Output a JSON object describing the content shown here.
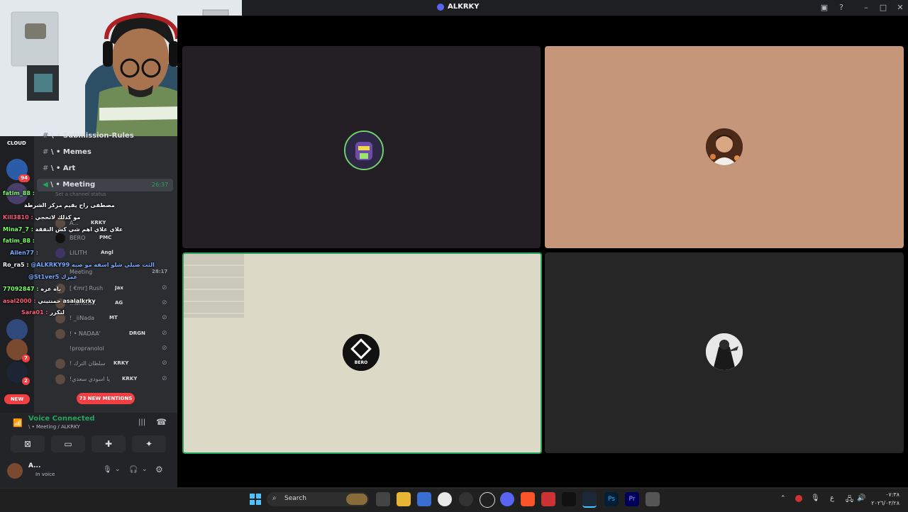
{
  "window": {
    "title": "ALKRKY",
    "title_icon": "discord-icon"
  },
  "channels": [
    {
      "label": "\\ • Submission-Rules"
    },
    {
      "label": "\\ • Memes"
    },
    {
      "label": "\\ • Art"
    },
    {
      "label": "\\ • Meeting",
      "time": "26:37",
      "status_placeholder": "Set a channel status"
    }
  ],
  "members": [
    {
      "name": "A...",
      "tag": "KRKY"
    },
    {
      "name": "BERO",
      "tag": "PMC"
    },
    {
      "name": "LILITH",
      "tag": "Angl"
    },
    {
      "name": "Meeting",
      "tag": "28:17"
    },
    {
      "name": "[ €mr] Rush",
      "tag": "Jax"
    },
    {
      "name": "...amoud.",
      "tag": "AG"
    },
    {
      "name": "! _iiNada",
      "tag": "MT"
    },
    {
      "name": "! • NADAA'",
      "tag": "DRGN"
    },
    {
      "name": "!propranolol",
      "tag": ""
    },
    {
      "name": "! سلطان الترك",
      "tag": "KRKY"
    },
    {
      "name": "!يا اسودي سعدي",
      "tag": "KRKY"
    }
  ],
  "server_badges": [
    "94",
    "7",
    "2"
  ],
  "server_labels": {
    "cloud": "CLOUD",
    "new": "NEW"
  },
  "mentions_pill": "73 NEW MENTIONS",
  "chat_lines": [
    {
      "user": "fatim_88 :",
      "msg": "",
      "color": "cu"
    },
    {
      "user": "",
      "msg": "مصطفى راح يقيم مركز الشرطة",
      "color": "cw"
    },
    {
      "user": "Kill​3810 :",
      "msg": "مو كذلك لاتحجي",
      "color": "cr"
    },
    {
      "user": "Mina7_7 :",
      "msg": "علاي علاي اهم شي كش النفقة",
      "color": "cu"
    },
    {
      "user": "fatim_88 :",
      "msg": "",
      "color": "cu"
    },
    {
      "user": "Ailen77 :",
      "msg": "",
      "color": "cb"
    },
    {
      "user": "Ro_ra5 :",
      "msg": "@ALKRKY99 الثت صبلي شلو اسفه مو صبه",
      "color": "cw"
    },
    {
      "user": "",
      "msg": "@St1ver5 عمرك",
      "color": "cb"
    },
    {
      "user": "77092847 :",
      "msg": "باه عزه",
      "color": "cu"
    },
    {
      "user": "asal2000 :",
      "msg": "حمنتيني asalalkrky",
      "color": "cr"
    },
    {
      "user": "Sara01 :",
      "msg": "لتكرر",
      "color": "cr"
    }
  ],
  "voice": {
    "status": "Voice Connected",
    "location": "\\ • Meeting / ALKRKY",
    "user_name": "A...",
    "user_status": "In voice"
  },
  "tiles": [
    {
      "bg": "#231f24"
    },
    {
      "bg": "#c59679"
    },
    {
      "bg": "#dcd9c6",
      "label": "BERO",
      "speaking": true
    },
    {
      "bg": "#262626"
    }
  ],
  "taskbar": {
    "search_label": "Search",
    "clock_time": "٠٧:٣٨",
    "clock_date": "٢٠٢٦/٠٣/٢٨",
    "lang": "ع"
  },
  "colors": {
    "accent_green": "#23a55a",
    "danger": "#f23f43",
    "blurple": "#5865f2"
  }
}
